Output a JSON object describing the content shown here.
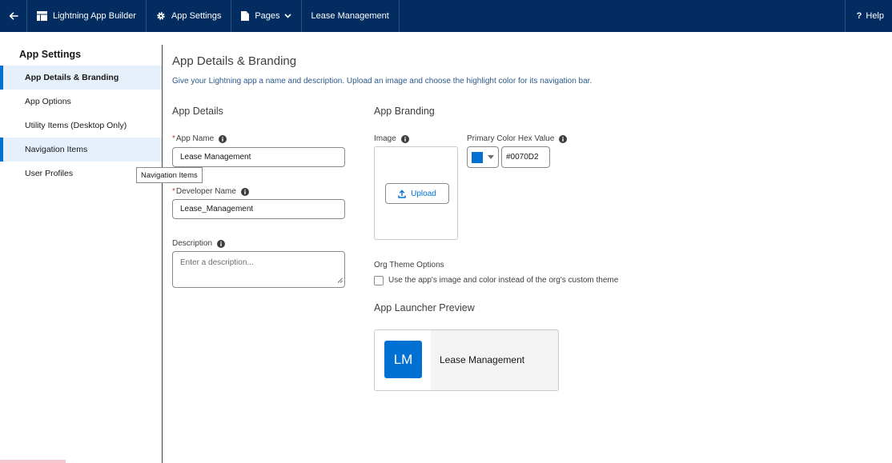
{
  "topbar": {
    "builder": "Lightning App Builder",
    "app_settings": "App Settings",
    "pages": "Pages",
    "app_name": "Lease Management",
    "help": "Help"
  },
  "sidebar": {
    "title": "App Settings",
    "items": [
      {
        "label": "App Details & Branding"
      },
      {
        "label": "App Options"
      },
      {
        "label": "Utility Items (Desktop Only)"
      },
      {
        "label": "Navigation Items"
      },
      {
        "label": "User Profiles"
      }
    ],
    "tooltip": "Navigation Items"
  },
  "main": {
    "title": "App Details & Branding",
    "description": "Give your Lightning app a name and description. Upload an image and choose the highlight color for its navigation bar.",
    "details": {
      "title": "App Details",
      "app_name_label": "App Name",
      "app_name_value": "Lease Management",
      "dev_name_label": "Developer Name",
      "dev_name_value": "Lease_Management",
      "desc_label": "Description",
      "desc_placeholder": "Enter a description..."
    },
    "branding": {
      "title": "App Branding",
      "image_label": "Image",
      "upload_label": "Upload",
      "color_label": "Primary Color Hex Value",
      "color_value": "#0070D2",
      "org_theme_label": "Org Theme Options",
      "org_theme_checkbox": "Use the app's image and color instead of the org's custom theme",
      "launcher_title": "App Launcher Preview",
      "launcher_initials": "LM",
      "launcher_name": "Lease Management"
    }
  },
  "colors": {
    "topbar": "#032d60",
    "brand": "#0070d2",
    "selected_bg": "#e6f0fa"
  },
  "icons": {
    "back": "arrow-left-icon",
    "builder": "app-builder-icon",
    "settings": "gear-icon",
    "pages": "page-icon",
    "help": "question-icon"
  }
}
